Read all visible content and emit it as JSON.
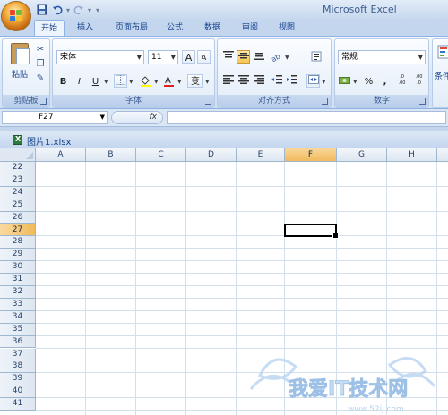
{
  "app": {
    "title": "Microsoft Excel"
  },
  "qat": {
    "save": "💾",
    "undo": "↶",
    "redo": "↷",
    "customize": "▾"
  },
  "tabs": [
    {
      "label": "开始",
      "active": true
    },
    {
      "label": "插入"
    },
    {
      "label": "页面布局"
    },
    {
      "label": "公式"
    },
    {
      "label": "数据"
    },
    {
      "label": "审阅"
    },
    {
      "label": "视图"
    }
  ],
  "ribbon": {
    "clipboard": {
      "label": "剪贴板",
      "paste_label": "粘贴"
    },
    "font": {
      "label": "字体",
      "font_name": "宋体",
      "font_size": "11",
      "bold": "B",
      "italic": "I",
      "underline": "U",
      "grow": "A",
      "shrink": "A",
      "phonetic": "变"
    },
    "alignment": {
      "label": "对齐方式"
    },
    "number": {
      "label": "数字",
      "format": "常规",
      "percent": "%",
      "comma": ",",
      "inc_decimal": ".0 .00",
      "dec_decimal": ".00 .0"
    },
    "styles": {
      "partial_label": "条件"
    }
  },
  "formula_bar": {
    "name_box": "F27",
    "fx": "fx",
    "formula": ""
  },
  "workbook": {
    "filename": "图片1.xlsx"
  },
  "grid": {
    "columns": [
      "A",
      "B",
      "C",
      "D",
      "E",
      "F",
      "G",
      "H"
    ],
    "selected_column": "F",
    "rows": [
      "22",
      "23",
      "24",
      "25",
      "26",
      "27",
      "28",
      "29",
      "30",
      "31",
      "32",
      "33",
      "34",
      "35",
      "36",
      "37",
      "38",
      "39",
      "40",
      "41"
    ],
    "selected_row": "27"
  },
  "watermark": {
    "text": "我爱IT技术网",
    "url": "www.52ij.com"
  },
  "colors": {
    "ribbon_text": "#15428b",
    "selected_header": "#f1ba5c",
    "grid_line": "#d4dfec"
  }
}
